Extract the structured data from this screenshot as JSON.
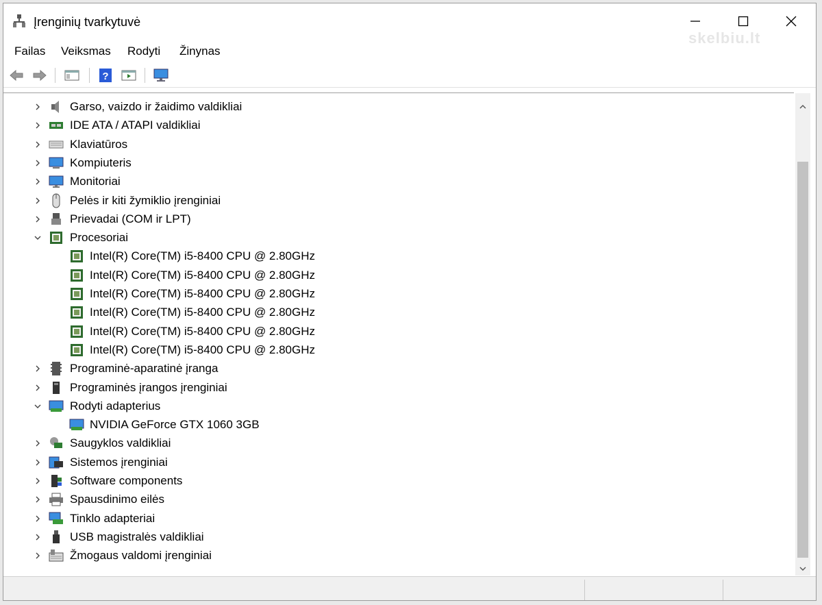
{
  "window": {
    "title": "Įrenginių tvarkytuvė",
    "watermark": "skelbiu.lt"
  },
  "menu": [
    "Failas",
    "Veiksmas",
    "Rodyti",
    "Žinynas"
  ],
  "tree": [
    {
      "label": "Garso, vaizdo ir žaidimo valdikliai",
      "icon": "speaker-icon",
      "level": 0,
      "expanded": false
    },
    {
      "label": "IDE ATA / ATAPI valdikliai",
      "icon": "ide-controller-icon",
      "level": 0,
      "expanded": false
    },
    {
      "label": "Klaviatūros",
      "icon": "keyboard-icon",
      "level": 0,
      "expanded": false
    },
    {
      "label": "Kompiuteris",
      "icon": "computer-icon",
      "level": 0,
      "expanded": false
    },
    {
      "label": "Monitoriai",
      "icon": "monitor-icon",
      "level": 0,
      "expanded": false
    },
    {
      "label": "Pelės ir kiti žymiklio įrenginiai",
      "icon": "mouse-icon",
      "level": 0,
      "expanded": false
    },
    {
      "label": "Prievadai (COM ir LPT)",
      "icon": "port-icon",
      "level": 0,
      "expanded": false
    },
    {
      "label": "Procesoriai",
      "icon": "processor-icon",
      "level": 0,
      "expanded": true
    },
    {
      "label": "Intel(R) Core(TM) i5-8400 CPU @ 2.80GHz",
      "icon": "processor-icon",
      "level": 1
    },
    {
      "label": "Intel(R) Core(TM) i5-8400 CPU @ 2.80GHz",
      "icon": "processor-icon",
      "level": 1
    },
    {
      "label": "Intel(R) Core(TM) i5-8400 CPU @ 2.80GHz",
      "icon": "processor-icon",
      "level": 1
    },
    {
      "label": "Intel(R) Core(TM) i5-8400 CPU @ 2.80GHz",
      "icon": "processor-icon",
      "level": 1
    },
    {
      "label": "Intel(R) Core(TM) i5-8400 CPU @ 2.80GHz",
      "icon": "processor-icon",
      "level": 1
    },
    {
      "label": "Intel(R) Core(TM) i5-8400 CPU @ 2.80GHz",
      "icon": "processor-icon",
      "level": 1
    },
    {
      "label": "Programinė-aparatinė įranga",
      "icon": "firmware-icon",
      "level": 0,
      "expanded": false
    },
    {
      "label": "Programinės įrangos įrenginiai",
      "icon": "software-device-icon",
      "level": 0,
      "expanded": false
    },
    {
      "label": "Rodyti adapterius",
      "icon": "display-adapter-icon",
      "level": 0,
      "expanded": true
    },
    {
      "label": "NVIDIA GeForce GTX 1060 3GB",
      "icon": "display-adapter-icon",
      "level": 1
    },
    {
      "label": "Saugyklos valdikliai",
      "icon": "storage-controller-icon",
      "level": 0,
      "expanded": false
    },
    {
      "label": "Sistemos įrenginiai",
      "icon": "system-device-icon",
      "level": 0,
      "expanded": false
    },
    {
      "label": "Software components",
      "icon": "software-component-icon",
      "level": 0,
      "expanded": false
    },
    {
      "label": "Spausdinimo eilės",
      "icon": "printer-icon",
      "level": 0,
      "expanded": false
    },
    {
      "label": "Tinklo adapteriai",
      "icon": "network-adapter-icon",
      "level": 0,
      "expanded": false
    },
    {
      "label": "USB magistralės valdikliai",
      "icon": "usb-icon",
      "level": 0,
      "expanded": false
    },
    {
      "label": "Žmogaus valdomi įrenginiai",
      "icon": "hid-icon",
      "level": 0,
      "expanded": false
    }
  ]
}
